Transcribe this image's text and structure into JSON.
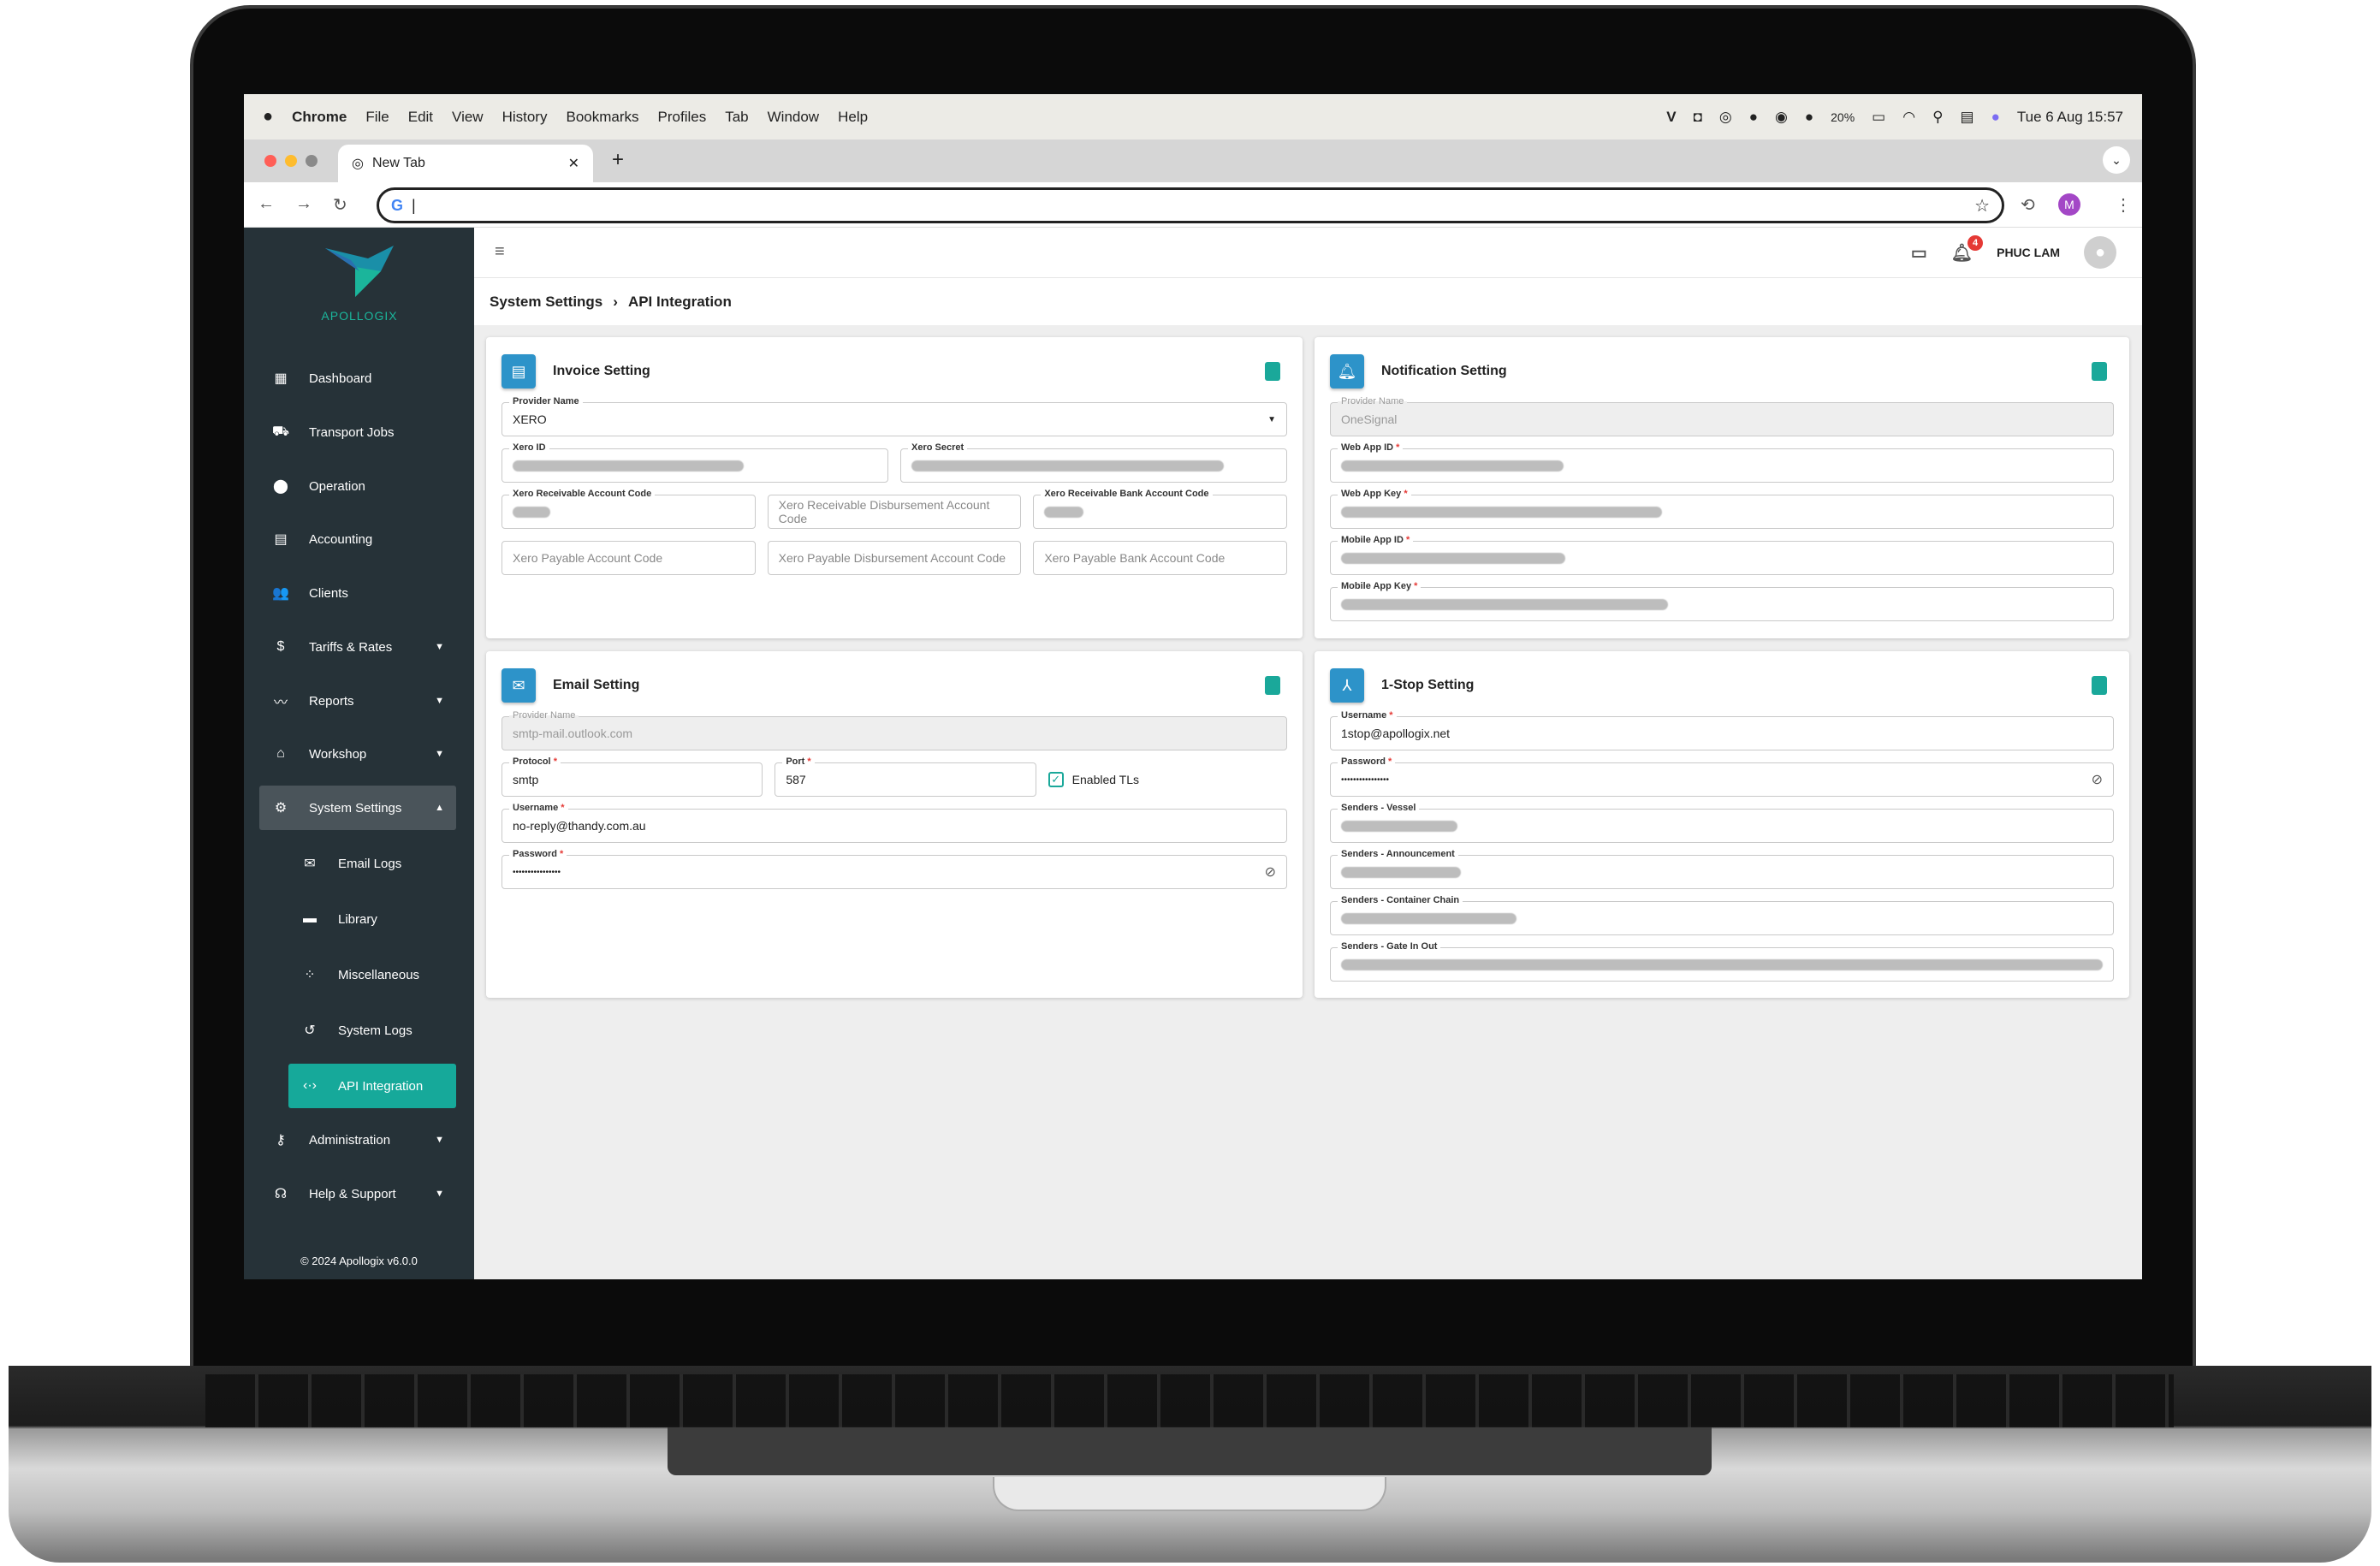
{
  "menubar": {
    "apple": "",
    "app": "Chrome",
    "items": [
      "File",
      "Edit",
      "View",
      "History",
      "Bookmarks",
      "Profiles",
      "Tab",
      "Window",
      "Help"
    ],
    "battery": "20%",
    "datetime": "Tue 6 Aug  15:57"
  },
  "browser": {
    "tab_title": "New Tab",
    "tab_close": "✕",
    "new_tab": "+",
    "profile_initial": "M"
  },
  "sidebar": {
    "logo_text": "APOLLOGIX",
    "items": [
      {
        "label": "Dashboard",
        "icon": "dashboard-icon"
      },
      {
        "label": "Transport Jobs",
        "icon": "truck-icon"
      },
      {
        "label": "Operation",
        "icon": "location-pin-icon"
      },
      {
        "label": "Accounting",
        "icon": "ledger-icon"
      },
      {
        "label": "Clients",
        "icon": "people-icon"
      },
      {
        "label": "Tariffs & Rates",
        "icon": "dollar-icon",
        "expandable": true
      },
      {
        "label": "Reports",
        "icon": "trend-icon",
        "expandable": true
      },
      {
        "label": "Workshop",
        "icon": "workshop-icon",
        "expandable": true
      },
      {
        "label": "System Settings",
        "icon": "gear-icon",
        "expandable": true,
        "open": true
      }
    ],
    "subitems": [
      {
        "label": "Email Logs",
        "icon": "mail-icon"
      },
      {
        "label": "Library",
        "icon": "briefcase-icon"
      },
      {
        "label": "Miscellaneous",
        "icon": "dots-icon"
      },
      {
        "label": "System Logs",
        "icon": "history-icon"
      },
      {
        "label": "API Integration",
        "icon": "code-arrows-icon",
        "active": true
      }
    ],
    "bottom_items": [
      {
        "label": "Administration",
        "icon": "key-icon"
      },
      {
        "label": "Help & Support",
        "icon": "headset-icon"
      }
    ],
    "footer": "© 2024 Apollogix v6.0.0"
  },
  "header": {
    "user": "PHUC LAM",
    "notification_count": "4"
  },
  "breadcrumb": {
    "parent": "System Settings",
    "separator": "›",
    "current": "API Integration"
  },
  "invoice": {
    "title": "Invoice Setting",
    "provider_label": "Provider Name",
    "provider_value": "XERO",
    "xero_id_label": "Xero ID",
    "xero_secret_label": "Xero Secret",
    "recv_account_label": "Xero Receivable Account Code",
    "recv_disb_placeholder": "Xero Receivable Disbursement Account Code",
    "recv_bank_label": "Xero Receivable Bank Account Code",
    "pay_account_placeholder": "Xero Payable Account Code",
    "pay_disb_placeholder": "Xero Payable Disbursement Account Code",
    "pay_bank_placeholder": "Xero Payable Bank Account Code"
  },
  "notification": {
    "title": "Notification Setting",
    "provider_label": "Provider Name",
    "provider_value": "OneSignal",
    "web_app_id_label": "Web App ID",
    "web_app_key_label": "Web App Key",
    "mobile_app_id_label": "Mobile App ID",
    "mobile_app_key_label": "Mobile App Key"
  },
  "email": {
    "title": "Email Setting",
    "provider_label": "Provider Name",
    "provider_value": "smtp-mail.outlook.com",
    "protocol_label": "Protocol",
    "protocol_value": "smtp",
    "port_label": "Port",
    "port_value": "587",
    "tls_label": "Enabled TLs",
    "tls_checked": true,
    "username_label": "Username",
    "username_value": "no-reply@thandy.com.au",
    "password_label": "Password",
    "password_value": "••••••••••••••••"
  },
  "onestop": {
    "title": "1-Stop Setting",
    "username_label": "Username",
    "username_value": "1stop@apollogix.net",
    "password_label": "Password",
    "password_value": "••••••••••••••••",
    "vessel_label": "Senders - Vessel",
    "announcement_label": "Senders - Announcement",
    "container_label": "Senders - Container Chain",
    "gate_label": "Senders - Gate In Out"
  },
  "colors": {
    "sidebar": "#263238",
    "accent": "#16a99a",
    "icon_blue": "#2d93c9",
    "required": "#e53935"
  }
}
